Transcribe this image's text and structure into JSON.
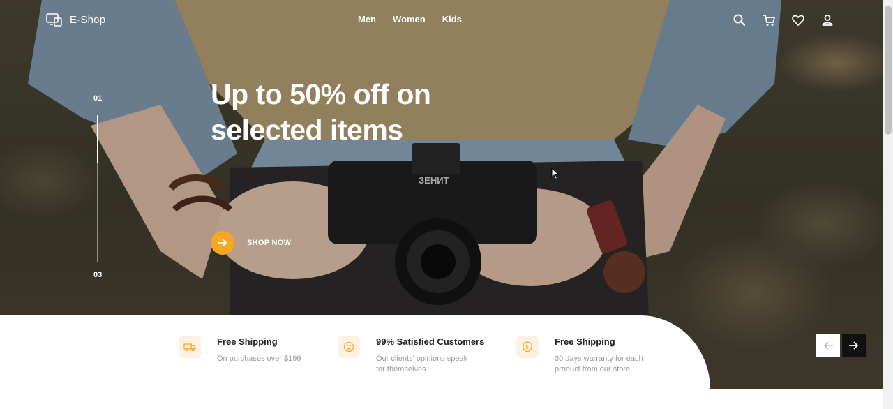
{
  "brand": {
    "name": "E-Shop"
  },
  "nav": {
    "items": [
      "Men",
      "Women",
      "Kids"
    ]
  },
  "header_icons": [
    "search-icon",
    "cart-icon",
    "heart-icon",
    "user-icon"
  ],
  "hero": {
    "headline": "Up to 50% off on selected items",
    "cta_label": "SHOP NOW",
    "slide_current": "01",
    "slide_total": "03",
    "slide_progress": 0.33
  },
  "features": [
    {
      "icon": "truck-icon",
      "title": "Free Shipping",
      "desc": "On purchases over $199"
    },
    {
      "icon": "smile-icon",
      "title": "99% Satisfied Customers",
      "desc": "Our clients' opinions speak for themselves"
    },
    {
      "icon": "shield-dollar-icon",
      "title": "Free Shipping",
      "desc": "30 days warranty for each product from our store"
    }
  ],
  "carousel": {
    "prev": "arrow-left-icon",
    "next": "arrow-right-icon"
  },
  "colors": {
    "accent": "#f5a623",
    "feature_icon_bg": "#fdf1e1",
    "dark": "#111111"
  }
}
